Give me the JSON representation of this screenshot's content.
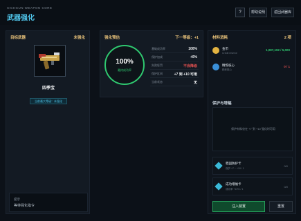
{
  "header": {
    "subtitle": "SICKGUN WEAPON CORE",
    "title": "武器强化",
    "help_label": "?",
    "buttons": [
      "帮助说明",
      "返回武器库"
    ]
  },
  "left_panel": {
    "title": "目标武器",
    "status": "未强化",
    "weapon_name": "四季宝",
    "max_tag": "当前最大等级：未强化",
    "hint_label": "提示",
    "hint_text": "等待强化指令"
  },
  "mid_panel": {
    "title": "强化预估",
    "next_level": "下一等级：+1",
    "success_rate": "100%",
    "success_label": "最终成功率",
    "stats": [
      {
        "k": "基础成功率",
        "v": "100%",
        "red": false
      },
      {
        "k": "保护加成",
        "v": "+0%",
        "red": false
      },
      {
        "k": "失败惩罚",
        "v": "不会降级",
        "red": true
      },
      {
        "k": "保护区间",
        "v": "+7 到 +10 可用",
        "red": false
      },
      {
        "k": "当前状态",
        "v": "无",
        "red": false
      }
    ]
  },
  "right_panel": {
    "title": "材料消耗",
    "count": "2 项",
    "materials": [
      {
        "name": "金币",
        "sub": "Credit reserve",
        "value": "1,087,192 / 5,000",
        "color": "#2fc970",
        "icon_color": "#e3b341"
      },
      {
        "name": "精炼核心",
        "sub": "精炼核心",
        "value": "0 / 1",
        "color": "#e05050",
        "icon_color": "#3a8fd8"
      }
    ],
    "protect_title": "保护与增幅",
    "protect_text": "保护材料仅在 +7 到 +10 强化时可用",
    "protect_items": [
      {
        "name": "稳固防护卡",
        "sub": "保护 +7 ~ +10 / 1",
        "right": "0/0"
      },
      {
        "name": "成功增幅卡",
        "sub": "成功率 +10% / 1",
        "right": "0/0"
      }
    ],
    "inject_label": "注入装置",
    "reset_label": "重置"
  },
  "colors": {
    "accent": "#4fc3e8",
    "gold": "#e8c27a",
    "green": "#2fc970",
    "red": "#e05050"
  }
}
